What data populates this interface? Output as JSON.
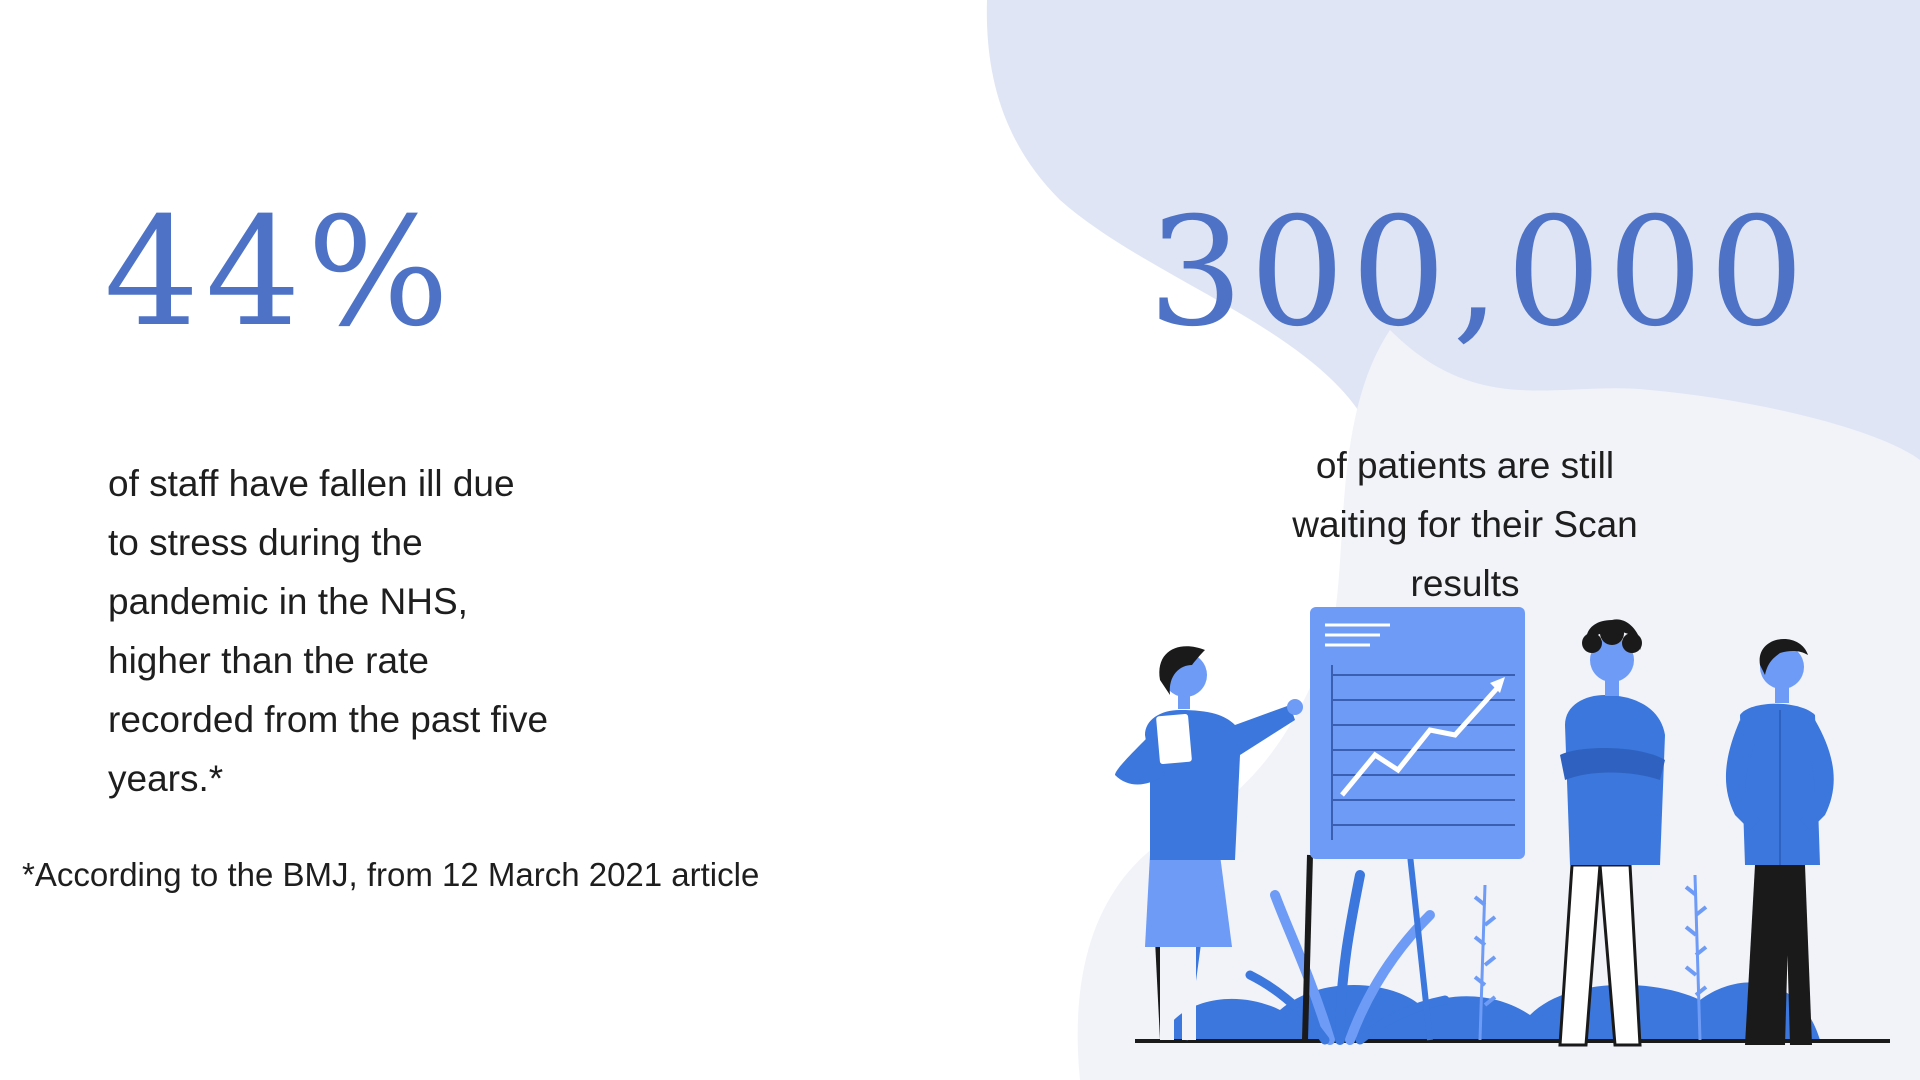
{
  "left_stat": {
    "value": "44%",
    "description": "of staff have fallen ill due\nto stress during the\npandemic in the NHS,\nhigher than the rate\nrecorded from the past five\nyears.*"
  },
  "right_stat": {
    "value": "300,000",
    "description": "of patients are still\nwaiting for their Scan\nresults"
  },
  "footnote": "*According to the BMJ, from 12 March 2021 article",
  "colors": {
    "accent": "#4e73c6",
    "blob": "#dfe5f4",
    "blob_light": "#f1f3f9",
    "figure_blue": "#3b77dc",
    "board_blue": "#6e9bf5",
    "dark": "#1a1a1a"
  },
  "illustration": {
    "icons": [
      "woman-with-clipboard-icon",
      "presentation-board-icon",
      "man-arms-crossed-icon",
      "man-hands-on-hips-icon",
      "plants-icon"
    ]
  }
}
